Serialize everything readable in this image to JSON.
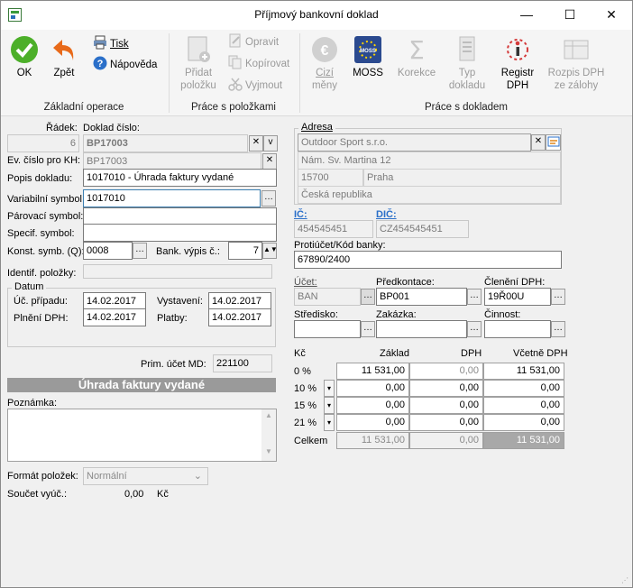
{
  "window": {
    "title": "Příjmový bankovní doklad",
    "minimize": "—",
    "maximize": "☐",
    "close": "✕"
  },
  "ribbon": {
    "groups": [
      "Základní operace",
      "Práce s položkami",
      "Práce s dokladem"
    ],
    "ok": "OK",
    "back": "Zpět",
    "print": "Tisk",
    "help": "Nápověda",
    "add_item": "Přidat",
    "add_item2": "položku",
    "edit": "Opravit",
    "copy": "Kopírovat",
    "cut": "Vyjmout",
    "foreign1": "Cizí",
    "foreign2": "měny",
    "moss": "MOSS",
    "correction": "Korekce",
    "doctype1": "Typ",
    "doctype2": "dokladu",
    "registr1": "Registr",
    "registr2": "DPH",
    "rozpis1": "Rozpis DPH",
    "rozpis2": "ze zálohy"
  },
  "left": {
    "radek_label": "Řádek:",
    "radek": "6",
    "doklad_label": "Doklad číslo:",
    "doklad": "BP17003",
    "ev_label": "Ev. číslo pro KH:",
    "ev": "BP17003",
    "popis_label": "Popis dokladu:",
    "popis": "1017010 - Úhrada faktury vydané",
    "vs_label": "Variabilní symbol:",
    "vs": "1017010",
    "parovaci_label": "Párovací symbol:",
    "parovaci": "",
    "ss_label": "Specif. symbol:",
    "ss": "",
    "ks_label": "Konst. symb. (Q):",
    "ks": "0008",
    "bank_label": "Bank. výpis č.:",
    "bank": "7",
    "identif_label": "Identif. položky:",
    "datum_title": "Datum",
    "uc_label": "Úč. případu:",
    "uc": "14.02.2017",
    "vyst_label": "Vystavení:",
    "vyst": "14.02.2017",
    "plneni_label": "Plnění DPH:",
    "plneni": "14.02.2017",
    "platby_label": "Platby:",
    "platby": "14.02.2017",
    "prim_label": "Prim. účet MD:",
    "prim": "221100",
    "banner": "Úhrada faktury vydané",
    "poznamka_label": "Poznámka:",
    "format_label": "Formát položek:",
    "format": "Normální",
    "soucet_label": "Součet vyúč.:",
    "soucet": "0,00",
    "soucet_unit": "Kč"
  },
  "right": {
    "adresa_title": "Adresa",
    "company": "Outdoor Sport s.r.o.",
    "street": "Nám. Sv. Martina 12",
    "zip": "15700",
    "city": "Praha",
    "country": "Česká republika",
    "ic_label": "IČ:",
    "ic": "454545451",
    "dic_label": "DIČ:",
    "dic": "CZ454545451",
    "protiucet_label": "Protiúčet/Kód banky:",
    "protiucet": "67890/2400",
    "ucet_label": "Účet:",
    "ucet": "BAN",
    "predkontace_label": "Předkontace:",
    "predkontace": "BP001",
    "cleneni_label": "Členění DPH:",
    "cleneni": "19Ř00U",
    "stredisko_label": "Středisko:",
    "zakazka_label": "Zakázka:",
    "cinnost_label": "Činnost:",
    "tbl": {
      "h_kc": "Kč",
      "h_zaklad": "Základ",
      "h_dph": "DPH",
      "h_vcetne": "Včetně DPH",
      "rows": [
        {
          "rate": "0 %",
          "zaklad": "11 531,00",
          "dph": "0,00",
          "vcetne": "11 531,00"
        },
        {
          "rate": "10 %",
          "zaklad": "0,00",
          "dph": "0,00",
          "vcetne": "0,00"
        },
        {
          "rate": "15 %",
          "zaklad": "0,00",
          "dph": "0,00",
          "vcetne": "0,00"
        },
        {
          "rate": "21 %",
          "zaklad": "0,00",
          "dph": "0,00",
          "vcetne": "0,00"
        }
      ],
      "total_label": "Celkem",
      "total_zaklad": "11 531,00",
      "total_dph": "0,00",
      "total_vcetne": "11 531,00"
    }
  },
  "colors": {
    "ok": "#4caf29",
    "back": "#e86a1a",
    "banner": "#9a9a9a",
    "moss": "#2b4a8f"
  }
}
